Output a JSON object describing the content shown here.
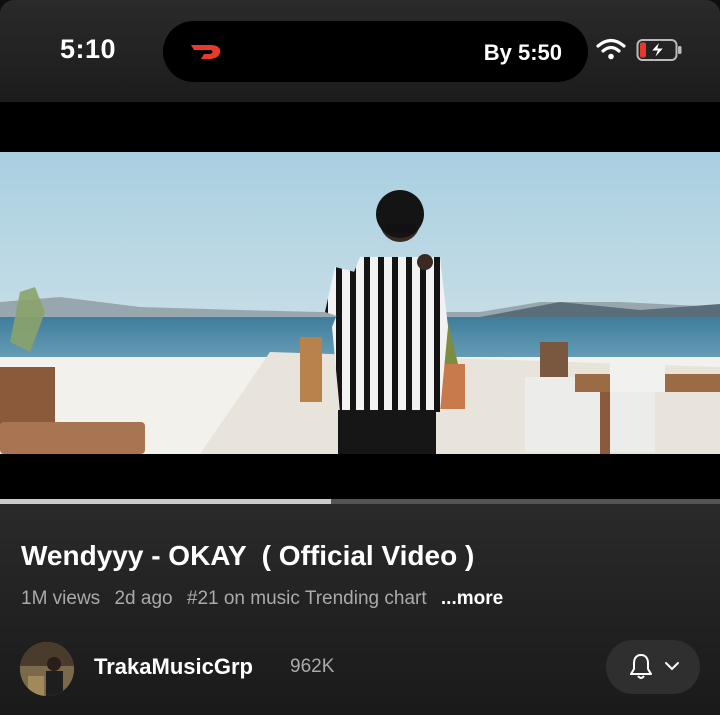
{
  "status_bar": {
    "time": "5:10",
    "live_activity": {
      "app_icon": "doordash-icon",
      "eta": "By 5:50",
      "accent_color": "#e8392f"
    },
    "icons": [
      "wifi-icon",
      "battery-charging-icon"
    ],
    "battery_color": "#e8392f"
  },
  "player": {
    "progress_fraction": 0.46
  },
  "video": {
    "title": "Wendyyy - OKAY  ( Official Video )",
    "views": "1M views",
    "age": "2d ago",
    "trending": "#21 on music Trending chart",
    "more_label": "...more"
  },
  "channel": {
    "name": "TrakaMusicGrp",
    "subscribers": "962K",
    "avatar_icon": "channel-avatar",
    "subscribe_icons": [
      "bell-icon",
      "chevron-down-icon"
    ]
  }
}
